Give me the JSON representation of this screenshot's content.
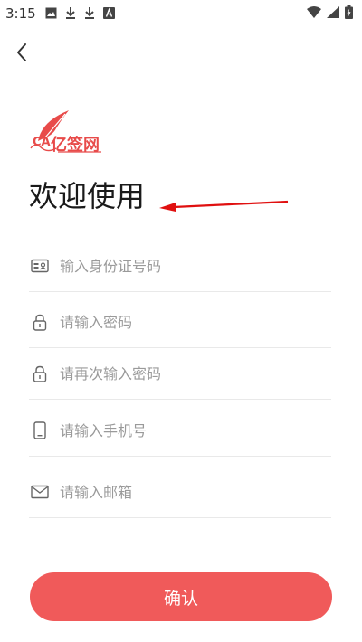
{
  "status_bar": {
    "time": "3:15",
    "left_icons": [
      "image-icon",
      "download-icon",
      "download-icon",
      "font-icon"
    ],
    "right_icons": [
      "wifi-icon",
      "signal-icon",
      "battery-charging-icon"
    ]
  },
  "header": {
    "back_icon": "chevron-left-icon"
  },
  "logo": {
    "ca": "CA",
    "name": "亿签网",
    "color": "#e84b4a"
  },
  "welcome_title": "欢迎使用",
  "form": {
    "fields": [
      {
        "icon": "id-card-icon",
        "placeholder": "输入身份证号码",
        "value": ""
      },
      {
        "icon": "lock-icon",
        "placeholder": "请输入密码",
        "value": ""
      },
      {
        "icon": "lock-icon",
        "placeholder": "请再次输入密码",
        "value": ""
      },
      {
        "icon": "phone-icon",
        "placeholder": "请输入手机号",
        "value": ""
      },
      {
        "icon": "mail-icon",
        "placeholder": "请输入邮箱",
        "value": ""
      }
    ],
    "submit_label": "确认"
  },
  "colors": {
    "accent": "#f05a5a",
    "arrow": "#e01010"
  }
}
